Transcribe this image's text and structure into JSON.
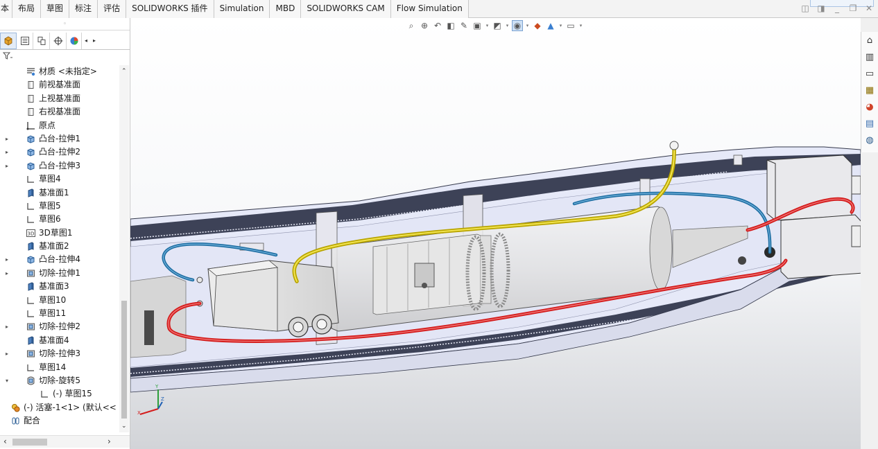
{
  "command_tabs": [
    "本",
    "布局",
    "草图",
    "标注",
    "评估",
    "SOLIDWORKS 插件",
    "Simulation",
    "MBD",
    "SOLIDWORKS CAM",
    "Flow Simulation"
  ],
  "feature_tree": [
    {
      "label": "材质 <未指定>",
      "icon": "material-icon",
      "depth": 1,
      "expander": false
    },
    {
      "label": "前视基准面",
      "icon": "plane-icon",
      "depth": 1,
      "expander": false
    },
    {
      "label": "上视基准面",
      "icon": "plane-icon",
      "depth": 1,
      "expander": false
    },
    {
      "label": "右视基准面",
      "icon": "plane-icon",
      "depth": 1,
      "expander": false
    },
    {
      "label": "原点",
      "icon": "origin-icon",
      "depth": 1,
      "expander": false
    },
    {
      "label": "凸台-拉伸1",
      "icon": "extrude-boss-icon",
      "depth": 1,
      "expander": true
    },
    {
      "label": "凸台-拉伸2",
      "icon": "extrude-boss-icon",
      "depth": 1,
      "expander": true
    },
    {
      "label": "凸台-拉伸3",
      "icon": "extrude-boss-icon",
      "depth": 1,
      "expander": true
    },
    {
      "label": "草图4",
      "icon": "sketch-icon",
      "depth": 1,
      "expander": false
    },
    {
      "label": "基准面1",
      "icon": "ref-plane-icon",
      "depth": 1,
      "expander": false
    },
    {
      "label": "草图5",
      "icon": "sketch-icon",
      "depth": 1,
      "expander": false
    },
    {
      "label": "草图6",
      "icon": "sketch-icon",
      "depth": 1,
      "expander": false
    },
    {
      "label": "3D草图1",
      "icon": "sketch-3d-icon",
      "depth": 1,
      "expander": false
    },
    {
      "label": "基准面2",
      "icon": "ref-plane-icon",
      "depth": 1,
      "expander": false
    },
    {
      "label": "凸台-拉伸4",
      "icon": "extrude-boss-icon",
      "depth": 1,
      "expander": true
    },
    {
      "label": "切除-拉伸1",
      "icon": "extrude-cut-icon",
      "depth": 1,
      "expander": true
    },
    {
      "label": "基准面3",
      "icon": "ref-plane-icon",
      "depth": 1,
      "expander": false
    },
    {
      "label": "草图10",
      "icon": "sketch-icon",
      "depth": 1,
      "expander": false
    },
    {
      "label": "草图11",
      "icon": "sketch-icon",
      "depth": 1,
      "expander": false
    },
    {
      "label": "切除-拉伸2",
      "icon": "extrude-cut-icon",
      "depth": 1,
      "expander": true
    },
    {
      "label": "基准面4",
      "icon": "ref-plane-icon",
      "depth": 1,
      "expander": false
    },
    {
      "label": "切除-拉伸3",
      "icon": "extrude-cut-icon",
      "depth": 1,
      "expander": true
    },
    {
      "label": "草图14",
      "icon": "sketch-icon",
      "depth": 1,
      "expander": false
    },
    {
      "label": "切除-旋转5",
      "icon": "revolve-cut-icon",
      "depth": 1,
      "expander": "open"
    },
    {
      "label": "(-) 草图15",
      "icon": "sketch-icon",
      "depth": 2,
      "expander": false
    },
    {
      "label": "(-) 活塞-1<1> (默认<<",
      "icon": "component-icon",
      "depth": 0,
      "expander": true
    },
    {
      "label": "配合",
      "icon": "mates-icon",
      "depth": 0,
      "expander": true
    }
  ],
  "colors": {
    "accent": "#1e5fb4",
    "wire_red": "#d41c1c",
    "wire_blue": "#1f6fa3",
    "wire_yellow": "#d9c400",
    "housing_light": "#e6e9f8",
    "housing_dark": "#3a3f55"
  },
  "icons": {
    "heads_up": [
      "zoom-to-fit-icon",
      "zoom-area-icon",
      "previous-view-icon",
      "section-view-icon",
      "dynamic-annotation-icon",
      "view-orientation-icon",
      "display-style-icon",
      "hide-show-icon",
      "edit-appearance-icon",
      "apply-scene-icon",
      "view-settings-icon"
    ],
    "task_pane": [
      "home-icon",
      "resources-icon",
      "design-library-icon",
      "file-explorer-icon",
      "appearances-icon",
      "custom-properties-icon",
      "solidworks-forum-icon"
    ],
    "panel_tabs": [
      "feature-manager-icon",
      "property-manager-icon",
      "configuration-manager-icon",
      "dimxpert-icon",
      "display-manager-icon"
    ]
  }
}
